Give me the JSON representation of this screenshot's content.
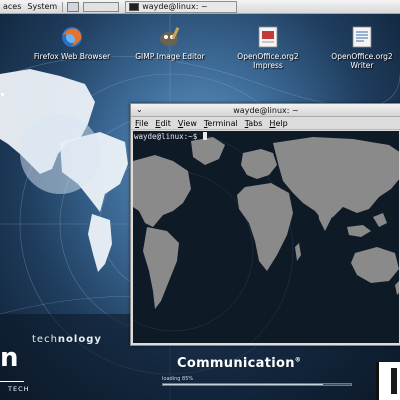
{
  "top_panel": {
    "menus": [
      "aces",
      "System"
    ],
    "task_button_label": "wayde@linux: ~"
  },
  "desktop_icons": [
    {
      "label": "Firefox Web Browser",
      "icon": "firefox-icon"
    },
    {
      "label": "GIMP Image Editor",
      "icon": "gimp-icon"
    },
    {
      "label": "OpenOffice.org2 Impress",
      "icon": "impress-icon"
    },
    {
      "label": "OpenOffice.org2 Writer",
      "icon": "writer-icon"
    }
  ],
  "terminal": {
    "title": "wayde@linux: ~",
    "menu_items": [
      "File",
      "Edit",
      "View",
      "Terminal",
      "Tabs",
      "Help"
    ],
    "prompt": "wayde@linux:~$ "
  },
  "wallpaper": {
    "technology_prefix": "tech",
    "technology_suffix": "nology",
    "communication": "Communication",
    "registered_mark": "®",
    "loading_text": "loading 85%",
    "loading_progress": 0.85,
    "tech_label": "TECH",
    "left_letter": "n"
  },
  "colors": {
    "panel_bg": "#e6e6e6",
    "terminal_bg": "#0f1a27",
    "continent_gray": "#8a8a8a",
    "wallpaper_blue": "#3f6e9b"
  }
}
